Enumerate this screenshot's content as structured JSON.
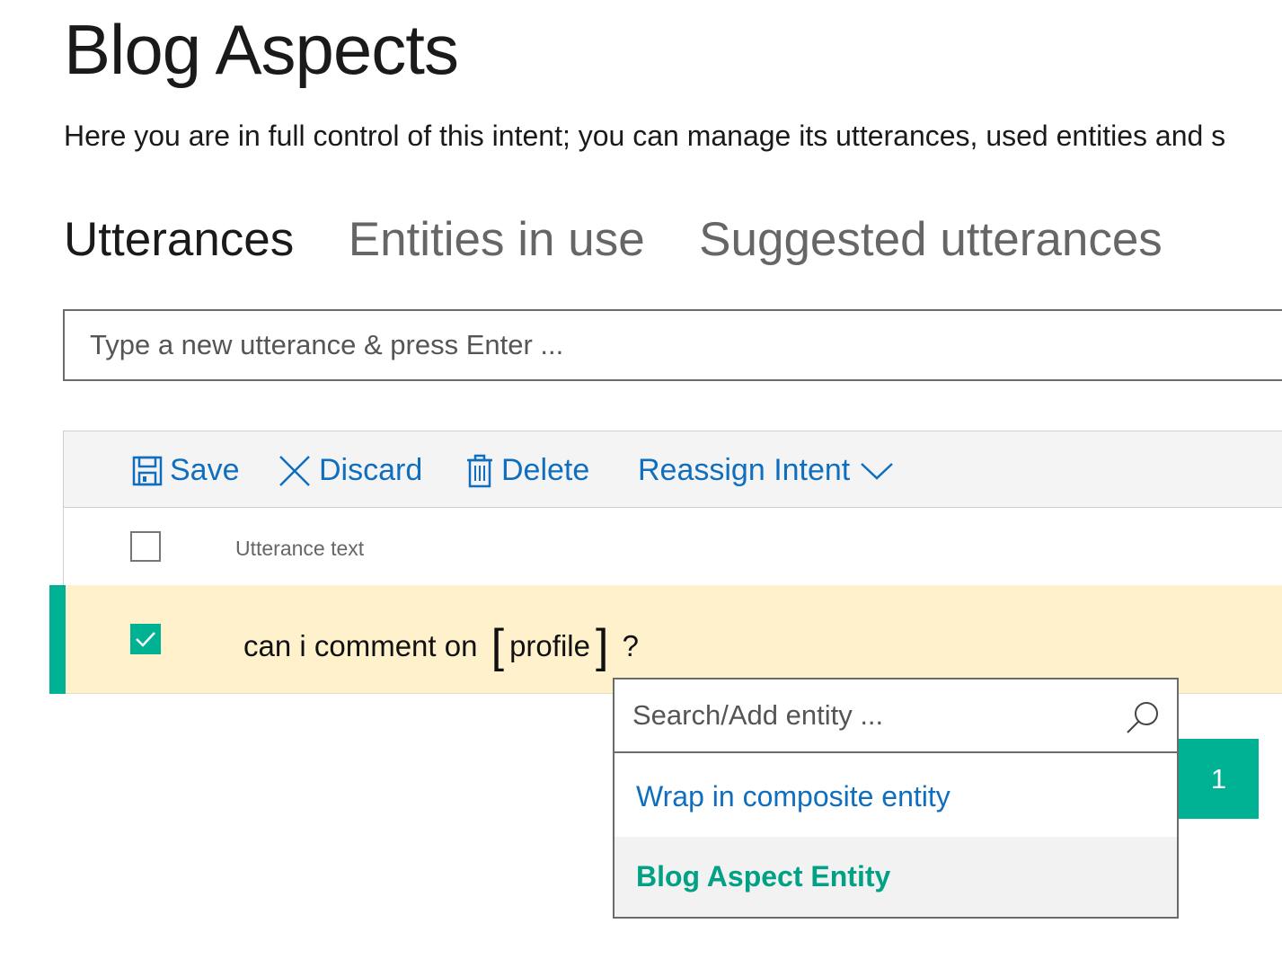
{
  "page": {
    "title": "Blog Aspects",
    "subtitle": "Here you are in full control of this intent; you can manage its utterances, used entities and s"
  },
  "tabs": [
    {
      "label": "Utterances",
      "active": true
    },
    {
      "label": "Entities in use",
      "active": false
    },
    {
      "label": "Suggested utterances",
      "active": false
    }
  ],
  "utterance_input": {
    "placeholder": "Type a new utterance & press Enter ...",
    "value": ""
  },
  "toolbar": {
    "save_label": "Save",
    "discard_label": "Discard",
    "delete_label": "Delete",
    "reassign_label": "Reassign Intent"
  },
  "table": {
    "column_header": "Utterance text",
    "select_all_checked": false,
    "rows": [
      {
        "checked": true,
        "text_before": "can i comment on",
        "entity": "profile",
        "text_after": "?"
      }
    ]
  },
  "entity_popup": {
    "search_placeholder": "Search/Add entity ...",
    "wrap_label": "Wrap in composite entity",
    "entity_option": "Blog Aspect Entity"
  },
  "badge": {
    "count": "1"
  },
  "colors": {
    "accent": "#00b294",
    "link": "#106ebe",
    "selected_row": "#fff1cc",
    "toolbar_bg": "#f4f4f4"
  }
}
